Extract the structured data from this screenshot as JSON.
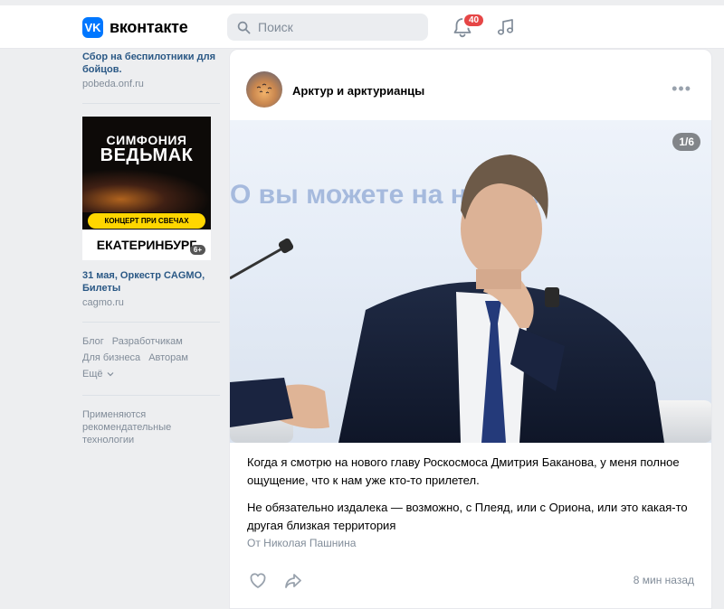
{
  "header": {
    "logo_mark": "VK",
    "logo_text": "вконтакте",
    "search_placeholder": "Поиск",
    "notifications_count": "40",
    "icons": [
      "vk-logo-icon",
      "search-icon",
      "bell-icon",
      "music-note-icon"
    ]
  },
  "sidebar": {
    "ad1": {
      "title": "Сбор на беспилотники для бойцов.",
      "domain": "pobeda.onf.ru"
    },
    "ad2": {
      "poster_line1": "СИМФОНИЯ",
      "poster_line2": "ВЕДЬМАК",
      "poster_band": "КОНЦЕРТ ПРИ СВЕЧАХ",
      "poster_city": "ЕКАТЕРИНБУРГ",
      "poster_age": "6+",
      "title": "31 мая, Оркестр CAGMO, Билеты",
      "domain": "cagmo.ru"
    },
    "links": [
      "Блог",
      "Разработчикам",
      "Для бизнеса",
      "Авторам"
    ],
    "more_label": "Ещё",
    "recommendation_note": "Применяются рекомендательные технологии"
  },
  "post": {
    "author": "Арктур и арктурианцы",
    "photo_counter": "1/6",
    "photo_backdrop_text": "О вы можете на нашем",
    "paragraph1": "Когда я смотрю на нового главу Роскосмоса Дмитрия Баканова, у меня полное ощущение, что к нам уже кто-то прилетел.",
    "paragraph2": "Не обязательно издалека — возможно, с Плеяд, или с Ориона, или это какая-то другая близкая территория",
    "from_label": "От Николая Пашнина",
    "time": "8 мин назад"
  },
  "colors": {
    "brand": "#0077ff",
    "link": "#2a5885",
    "badge": "#e64646",
    "muted": "#818c99",
    "background": "#edeef0"
  }
}
